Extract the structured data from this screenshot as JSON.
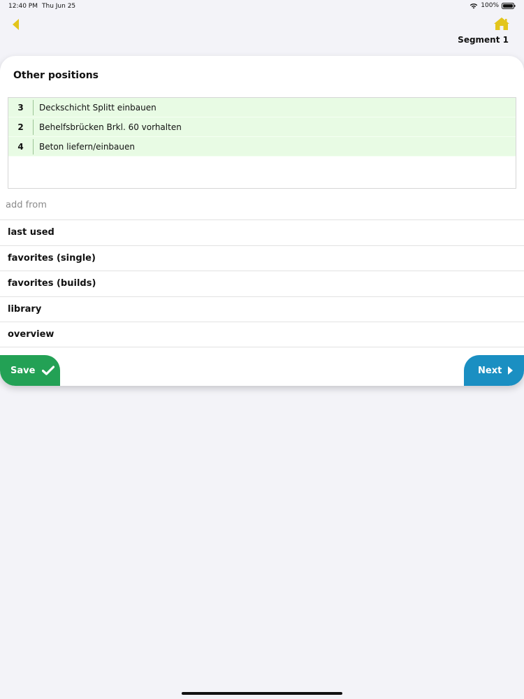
{
  "status_bar": {
    "time": "12:40 PM",
    "date": "Thu Jun 25",
    "battery": "100%"
  },
  "header": {
    "segment": "Segment 1"
  },
  "card": {
    "title": "Other positions",
    "positions": [
      {
        "number": "3",
        "text": "Deckschicht Splitt einbauen"
      },
      {
        "number": "2",
        "text": "Behelfsbrücken Brkl. 60 vorhalten"
      },
      {
        "number": "4",
        "text": "Beton liefern/einbauen"
      }
    ],
    "add_from_label": "add from",
    "menu": [
      {
        "label": "last used"
      },
      {
        "label": "favorites (single)"
      },
      {
        "label": "favorites (builds)"
      },
      {
        "label": "library"
      },
      {
        "label": "overview"
      }
    ],
    "save_label": "Save",
    "next_label": "Next"
  },
  "colors": {
    "accent_yellow": "#e3c51c",
    "save_green": "#23a155",
    "next_blue": "#1a8fc2",
    "row_green": "#e8fbe4"
  }
}
